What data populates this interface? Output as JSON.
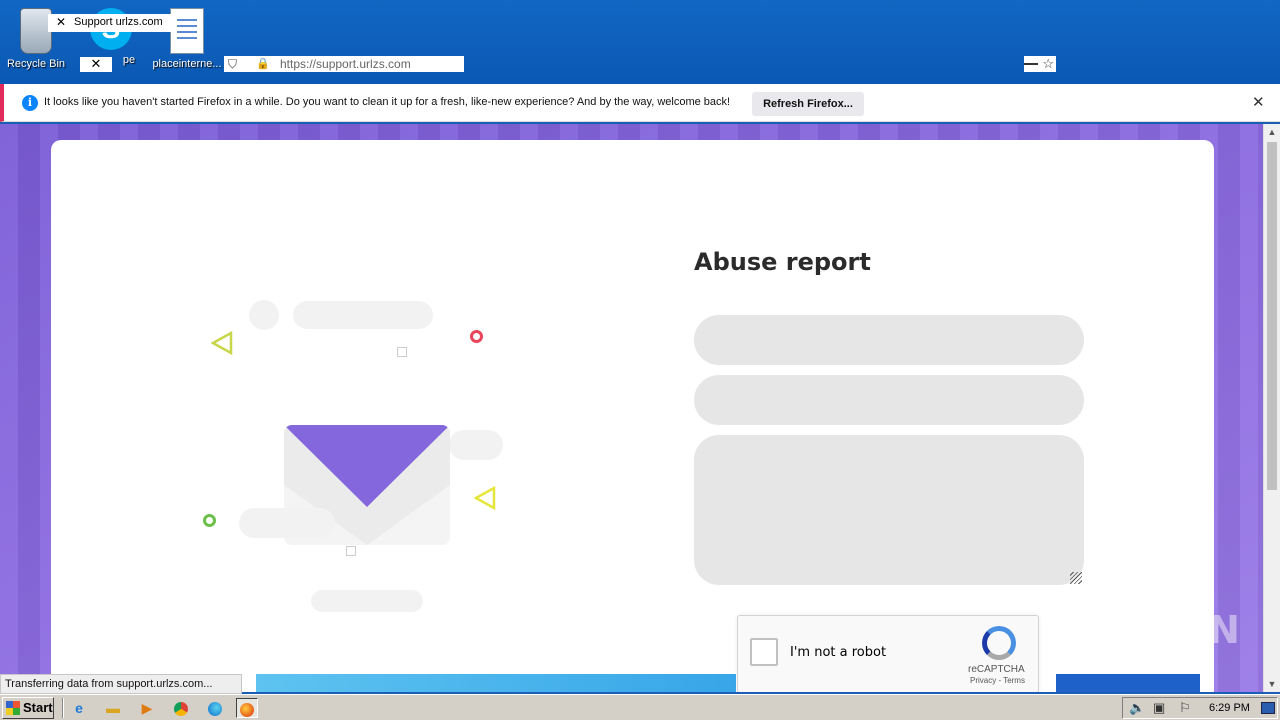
{
  "desktop": {
    "icons": [
      {
        "label": "Recycle Bin"
      },
      {
        "label": "pe"
      },
      {
        "label": "placeinterne..."
      }
    ],
    "skype_glyph": "S"
  },
  "browser": {
    "tab_title": "Support urlzs.com",
    "tab_close_glyph": "✕",
    "url": "https://support.urlzs.com",
    "bookmark_star": "☆"
  },
  "notification": {
    "info_glyph": "i",
    "message": "It looks like you haven't started Firefox in a while. Do you want to clean it up for a fresh, like-new experience? And by the way, welcome back!",
    "refresh_label": "Refresh Firefox...",
    "close_glyph": "✕"
  },
  "page": {
    "title": "Abuse report",
    "fields": {
      "name_placeholder": "",
      "email_placeholder": "",
      "message_placeholder": ""
    },
    "captcha": {
      "label": "I'm not a robot",
      "brand": "reCAPTCHA",
      "links": "Privacy - Terms"
    },
    "watermark": "ANY RUN"
  },
  "status_bar": {
    "text": "Transferring data from support.urlzs.com..."
  },
  "taskbar": {
    "start_label": "Start",
    "clock": "6:29 PM",
    "pinned": [
      "internet-explorer-icon",
      "folder-icon",
      "media-player-icon",
      "chrome-icon",
      "edge-icon",
      "firefox-icon"
    ]
  },
  "colors": {
    "accent_purple": "#8466dd",
    "notif_bar_edge": "#e02b5b",
    "info_blue": "#0a84ff",
    "dot_red": "#e8445a",
    "dot_green": "#6cc04a",
    "triangle_yellow": "#e6e63a",
    "triangle_olive": "#c8d64a"
  }
}
